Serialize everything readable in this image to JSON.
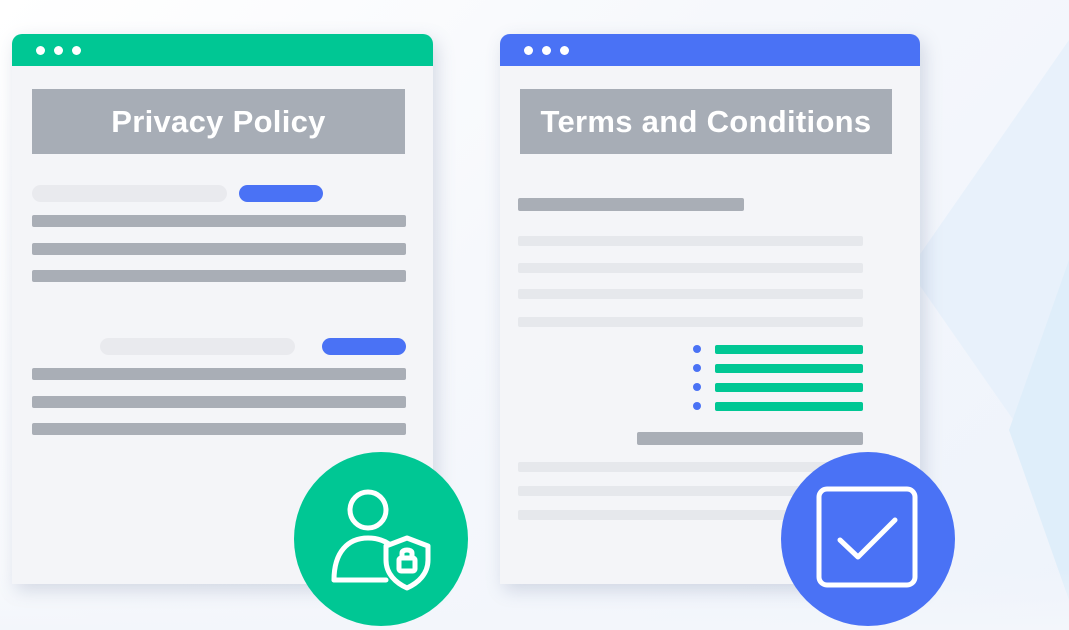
{
  "privacy_card": {
    "title": "Privacy Policy",
    "accent_color": "#00c794",
    "badge_icon": "user-shield-lock-icon"
  },
  "terms_card": {
    "title": "Terms and Conditions",
    "accent_color": "#4a72f5",
    "badge_icon": "checkbox-checked-icon"
  },
  "colors": {
    "placeholder_bar": "#a9aeb6",
    "placeholder_faint": "#e6e8ec",
    "window_body": "#f4f5f8"
  }
}
